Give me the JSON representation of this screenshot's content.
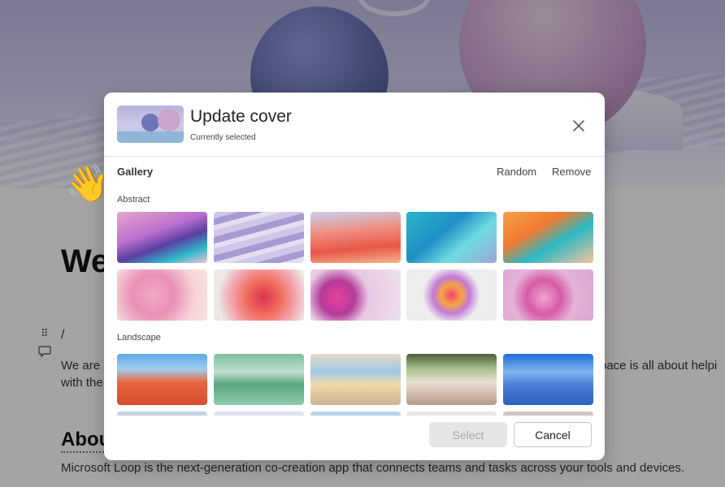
{
  "background_page": {
    "title_partial": "We",
    "slash_command": "/",
    "drag_handle_glyph": "⠿",
    "wave_emoji": "👋",
    "paragraph1_left": "We are",
    "paragraph1_right": "pace is all about helpi",
    "paragraph1_line2": "with the",
    "section_heading_partial": "Abou",
    "paragraph2": "Microsoft Loop is the next-generation co-creation app that connects teams and tasks across your tools and devices.",
    "paragraph3": ""
  },
  "dialog": {
    "title": "Update cover",
    "subtitle": "Currently selected",
    "gallery_label": "Gallery",
    "random_label": "Random",
    "remove_label": "Remove",
    "categories": [
      {
        "label": "Abstract"
      },
      {
        "label": "Landscape"
      }
    ],
    "select_label": "Select",
    "cancel_label": "Cancel"
  },
  "colors": {
    "accent_disabled_bg": "#e6e6e6",
    "overlay": "rgba(0,0,0,0.32)"
  }
}
